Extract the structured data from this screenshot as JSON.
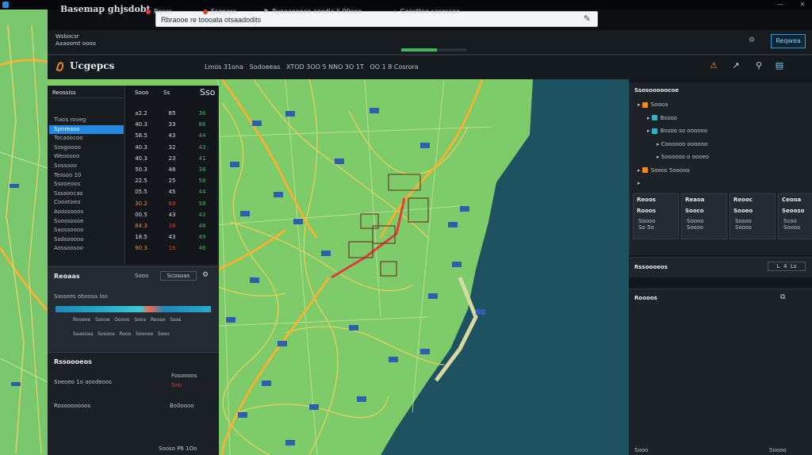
{
  "window": {
    "min": "—",
    "close": "✕"
  },
  "app": {
    "brand": "Basemap ghjsdobt"
  },
  "search": {
    "value": "Rbraooe re toooata otsaadodits",
    "edit_icon": "pencil-icon"
  },
  "toolbar": {
    "items": [
      {
        "label": "Wsbocsr\nAaaoomt oooo",
        "dot": false
      },
      {
        "label": "Roccs",
        "dot": true
      },
      {
        "label": "Ssonass",
        "dot": true
      },
      {
        "label": "Ryoaaooeoo aoodio Ii 00ooe",
        "dot": false
      },
      {
        "label": "Geocttoe sacossoo",
        "dot": false
      }
    ],
    "progress": 0.55,
    "action_label": "Reqwea",
    "colors": {
      "accent": "#2f9cda",
      "progress": "#3fb85a",
      "alert": "#e3392e"
    }
  },
  "subbar": {
    "title": "Ucgepcs",
    "meta": "Lmos 31ona   Sodoeeas   XTOD 3OO 5 NNO 3O 1T   OO 1 8 Cosrora",
    "icons": [
      "warning-icon",
      "share-icon",
      "bookmark-icon",
      "layout-icon"
    ]
  },
  "left_list": {
    "header": "Reossiss",
    "items": [
      "Tiaos roveg",
      "Spnresoo",
      "Tocaoocoo",
      "Sosgoooo",
      "Weooooo",
      "Sossooo",
      "Tessoo 10",
      "Ssooeoos",
      "Sssaoocas",
      "Coootoeo",
      "Aoossooos",
      "Soossoooe",
      "Saossoooo",
      "Ssdsooooo",
      "Aossoosoo"
    ],
    "selected": 1
  },
  "left_table": {
    "headers": [
      "Sooo",
      "Ss",
      "Sso"
    ],
    "col_colors": [
      "#d8dde2",
      "#d8dde2",
      "#3fb85a"
    ],
    "rows": [
      [
        "a2.2",
        "85",
        "36"
      ],
      [
        "40.3",
        "33",
        "86"
      ],
      [
        "58.5",
        "43",
        "44"
      ],
      [
        "40.3",
        "32",
        "43"
      ],
      [
        "40.3",
        "23",
        "41"
      ],
      [
        "50.3",
        "48",
        "38"
      ],
      [
        "22.5",
        "25",
        "58"
      ],
      [
        "05.5",
        "45",
        "44"
      ],
      [
        "30.2",
        "68",
        "58"
      ],
      [
        "00.5",
        "43",
        "43"
      ],
      [
        "84.3",
        "38",
        "48"
      ],
      [
        "18.5",
        "43",
        "49"
      ],
      [
        "90.3",
        "16",
        "46"
      ]
    ],
    "hot_rows": [
      8,
      10,
      12
    ]
  },
  "timeline": {
    "title": "Reoaas",
    "btn_a": "Sooo",
    "btn_b": "Scosoas",
    "row_a": "Ssssees oboosa loo",
    "row_b": "Rooeee   Soooe   Goooo   Sooa   Reoae   Saas",
    "row_c": "Saasoaa   Sosooa   Rooo   Soooee   Soeo"
  },
  "notes": {
    "title": "Rssoooeos",
    "row_a_label": "Soeoeo 1o aoodeoos",
    "row_a_val": "Fosoooos",
    "row_a_val2": "Seo",
    "row_b_label": "Rosooooooos",
    "row_b_val": "Bo0oooo",
    "footer": [
      "Sooso",
      "P6",
      "1Oo"
    ]
  },
  "right_tree": {
    "header": "Ssosooooocoe",
    "rows": [
      {
        "label": "Soooa",
        "color": "#f08c1e",
        "indent": 0
      },
      {
        "label": "Bsooo",
        "color": "#2ab7c9",
        "indent": 1
      },
      {
        "label": "Bosoo so oooooo",
        "color": "#2ab7c9",
        "indent": 1
      },
      {
        "label": "Coooooo oooooo",
        "color": "",
        "indent": 2
      },
      {
        "label": "Soooooo o oooeo",
        "color": "",
        "indent": 2
      },
      {
        "label": "Sooos 5ooooo",
        "color": "#f08c1e",
        "indent": 0
      },
      {
        "label": "",
        "color": "",
        "indent": 0
      }
    ]
  },
  "right_cards": [
    {
      "title": "Reoos",
      "sub": "Rooos",
      "val": "Soooo\nSo 5o"
    },
    {
      "title": "Reaoa",
      "sub": "Sooco",
      "val": "Soooo\nSosoo"
    },
    {
      "title": "Reooc",
      "sub": "Sooeo",
      "val": "Sosoo\nSooos"
    },
    {
      "title": "Ceooa",
      "sub": "Seooso",
      "val": "Scoo\nSooos"
    }
  ],
  "right_legend": {
    "title": "Rssoooeos",
    "btn": "L  4  Ls"
  },
  "right_layers": {
    "title": "Roooos",
    "footer": [
      "Sooo",
      "Soooo"
    ]
  }
}
